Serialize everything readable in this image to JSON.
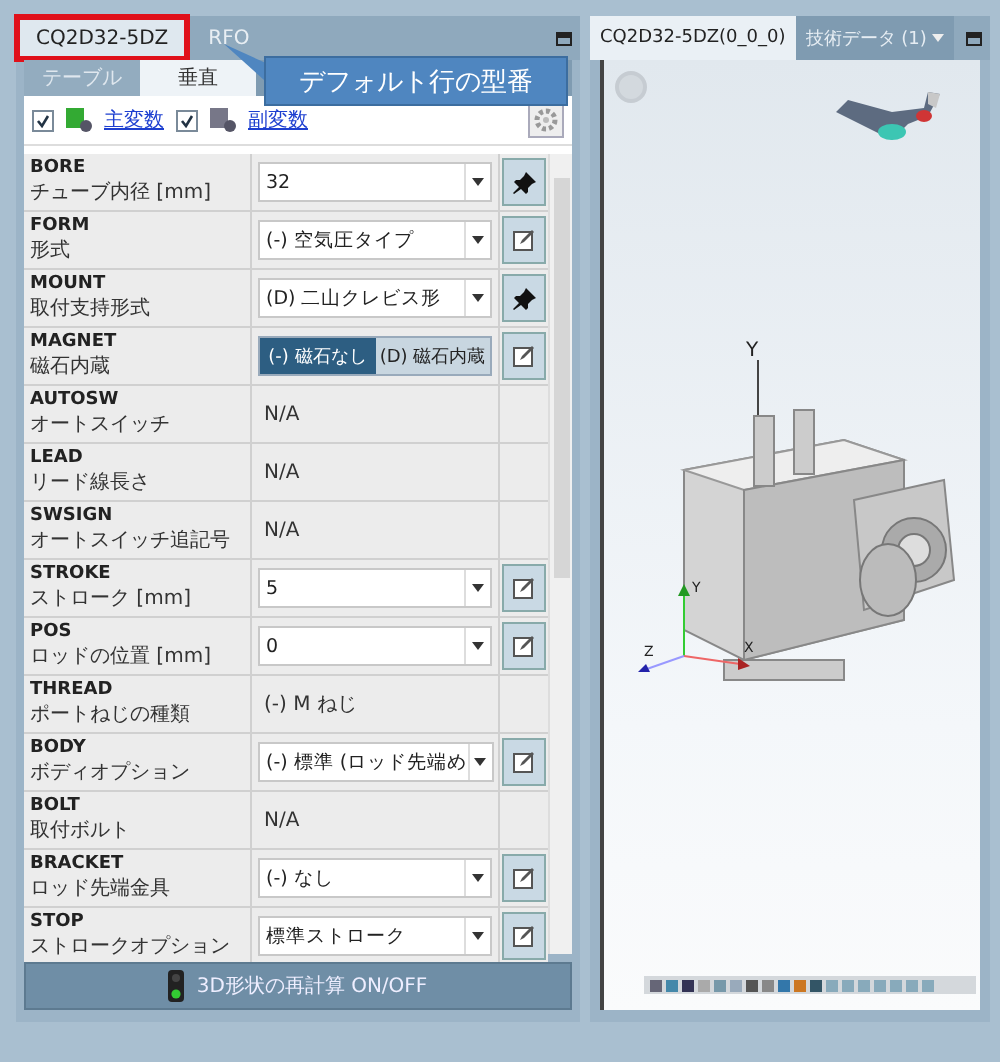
{
  "left_tabs": [
    {
      "label": "CQ2D32-5DZ",
      "selected": true,
      "outlined": true
    },
    {
      "label": "RFO",
      "selected": false,
      "outlined": false
    }
  ],
  "callout": "デフォルト行の型番",
  "view_tabs": [
    {
      "label": "テーブル",
      "selected": false
    },
    {
      "label": "垂直",
      "selected": true
    }
  ],
  "filters": [
    {
      "label": "主変数",
      "checked": true
    },
    {
      "label": "副変数",
      "checked": true
    }
  ],
  "rows": [
    {
      "code": "BORE",
      "name": "チューブ内径 [mm]",
      "kind": "select",
      "value": "32",
      "action": {
        "kind": "pin"
      }
    },
    {
      "code": "FORM",
      "name": "形式",
      "kind": "select",
      "value": "(-) 空気圧タイプ",
      "action": {
        "kind": "edit"
      }
    },
    {
      "code": "MOUNT",
      "name": "取付支持形式",
      "kind": "select",
      "value": "(D) 二山クレビス形",
      "action": {
        "kind": "pin"
      }
    },
    {
      "code": "MAGNET",
      "name": "磁石内蔵",
      "kind": "toggle",
      "options": [
        {
          "label": "(-) 磁石なし",
          "selected": true
        },
        {
          "label": "(D) 磁石内蔵",
          "selected": false
        }
      ],
      "action": {
        "kind": "edit"
      }
    },
    {
      "code": "AUTOSW",
      "name": "オートスイッチ",
      "kind": "text",
      "value": "N/A"
    },
    {
      "code": "LEAD",
      "name": "リード線長さ",
      "kind": "text",
      "value": "N/A"
    },
    {
      "code": "SWSIGN",
      "name": "オートスイッチ追記号",
      "kind": "text",
      "value": "N/A"
    },
    {
      "code": "STROKE",
      "name": "ストローク [mm]",
      "kind": "select",
      "value": "5",
      "action": {
        "kind": "edit"
      }
    },
    {
      "code": "POS",
      "name": "ロッドの位置 [mm]",
      "kind": "select",
      "value": "0",
      "action": {
        "kind": "edit"
      }
    },
    {
      "code": "THREAD",
      "name": "ポートねじの種類",
      "kind": "text",
      "value": "(-) M ねじ"
    },
    {
      "code": "BODY",
      "name": "ボディオプション",
      "kind": "select",
      "value": "(-) 標準 (ロッド先端め",
      "action": {
        "kind": "edit"
      }
    },
    {
      "code": "BOLT",
      "name": "取付ボルト",
      "kind": "text",
      "value": "N/A"
    },
    {
      "code": "BRACKET",
      "name": "ロッド先端金具",
      "kind": "select",
      "value": "(-) なし",
      "action": {
        "kind": "edit"
      }
    },
    {
      "code": "STOP",
      "name": "ストロークオプション",
      "kind": "select",
      "value": "標準ストローク",
      "action": {
        "kind": "edit"
      }
    }
  ],
  "recalc_button": "3D形状の再計算 ON/OFF",
  "viewer_tabs": [
    {
      "label": "CQ2D32-5DZ(0_0_0)",
      "selected": true,
      "dropdown": false
    },
    {
      "label": "技術データ (1)",
      "selected": false,
      "dropdown": true
    }
  ],
  "model_axis_label": "Y",
  "triad": {
    "y": "Y",
    "z": "Z",
    "x": "X"
  }
}
